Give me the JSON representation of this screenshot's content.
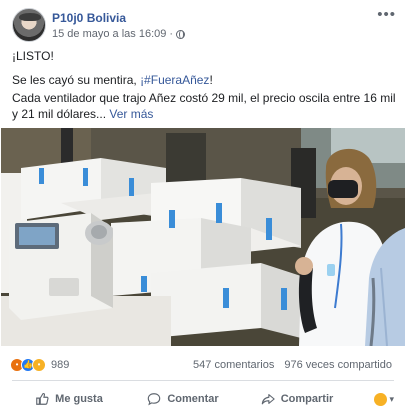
{
  "post": {
    "author": "P10j0 Bolivia",
    "timestamp": "15 de mayo a las 16:09",
    "visibility_dot": "·",
    "text_line1": "¡LISTO!",
    "text_line2_prefix": "Se les cayó su mentira, ",
    "hashtag": "¡#FueraAñez",
    "text_line2_suffix": "!",
    "text_line3": "Cada ventilador que trajo Añez costó 29 mil, el precio oscila entre 16 mil y 21 mil dólares...",
    "see_more": "Ver más"
  },
  "reactions": {
    "count": "989",
    "comments": "547 comentarios",
    "shares": "976 veces compartido",
    "icons": [
      "angry-icon",
      "like-icon",
      "wow-icon"
    ]
  },
  "actions": {
    "like": "Me gusta",
    "comment": "Comentar",
    "share": "Compartir"
  },
  "colors": {
    "link": "#365899",
    "muted": "#606770",
    "like_blue": "#2078f4",
    "angry": "#e9710f",
    "wow": "#f7b125"
  }
}
